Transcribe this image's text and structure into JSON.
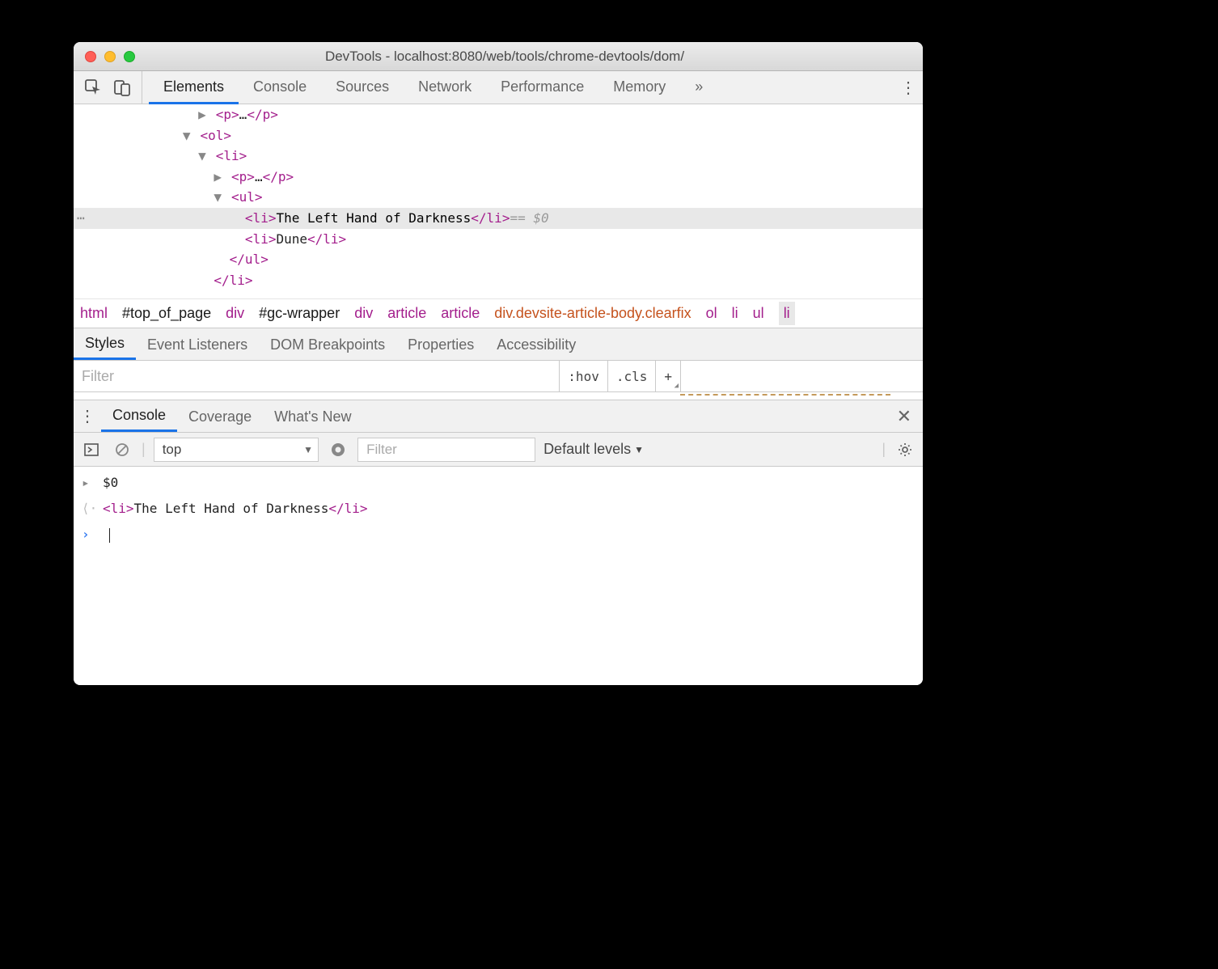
{
  "window": {
    "title": "DevTools - localhost:8080/web/tools/chrome-devtools/dom/"
  },
  "tabs": {
    "items": [
      "Elements",
      "Console",
      "Sources",
      "Network",
      "Performance",
      "Memory"
    ],
    "overflow": "»"
  },
  "tree": {
    "l1": "<p>",
    "l1d": "…",
    "l1c": "</p>",
    "l2": "<ol>",
    "l3": "<li>",
    "l4": "<p>",
    "l4d": "…",
    "l4c": "</p>",
    "l5": "<ul>",
    "sel_open": "<li>",
    "sel_text": "The Left Hand of Darkness",
    "sel_close": "</li>",
    "sel_hint": " == $0",
    "l7o": "<li>",
    "l7t": "Dune",
    "l7c": "</li>",
    "l8": "</ul>",
    "l9": "</li>"
  },
  "breadcrumbs": [
    {
      "text": "html",
      "cls": "tagc"
    },
    {
      "text": "#top_of_page",
      "cls": "idc"
    },
    {
      "text": "div",
      "cls": "tagc"
    },
    {
      "text": "#gc-wrapper",
      "cls": "idc"
    },
    {
      "text": "div",
      "cls": "tagc"
    },
    {
      "text": "article",
      "cls": "tagc"
    },
    {
      "text": "article",
      "cls": "tagc"
    },
    {
      "text": "div.devsite-article-body.clearfix",
      "cls": "classc"
    },
    {
      "text": "ol",
      "cls": "tagc"
    },
    {
      "text": "li",
      "cls": "tagc"
    },
    {
      "text": "ul",
      "cls": "tagc"
    },
    {
      "text": "li",
      "cls": "tagc sel"
    }
  ],
  "styles_tabs": [
    "Styles",
    "Event Listeners",
    "DOM Breakpoints",
    "Properties",
    "Accessibility"
  ],
  "styles_filter": "Filter",
  "styles_ctrls": {
    "hov": ":hov",
    "cls": ".cls",
    "plus": "+"
  },
  "drawer": {
    "tabs": [
      "Console",
      "Coverage",
      "What's New"
    ]
  },
  "console_toolbar": {
    "context": "top",
    "filter": "Filter",
    "levels": "Default levels"
  },
  "console_output": {
    "in": "$0",
    "out_open": "<li>",
    "out_text": "The Left Hand of Darkness",
    "out_close": "</li>"
  }
}
